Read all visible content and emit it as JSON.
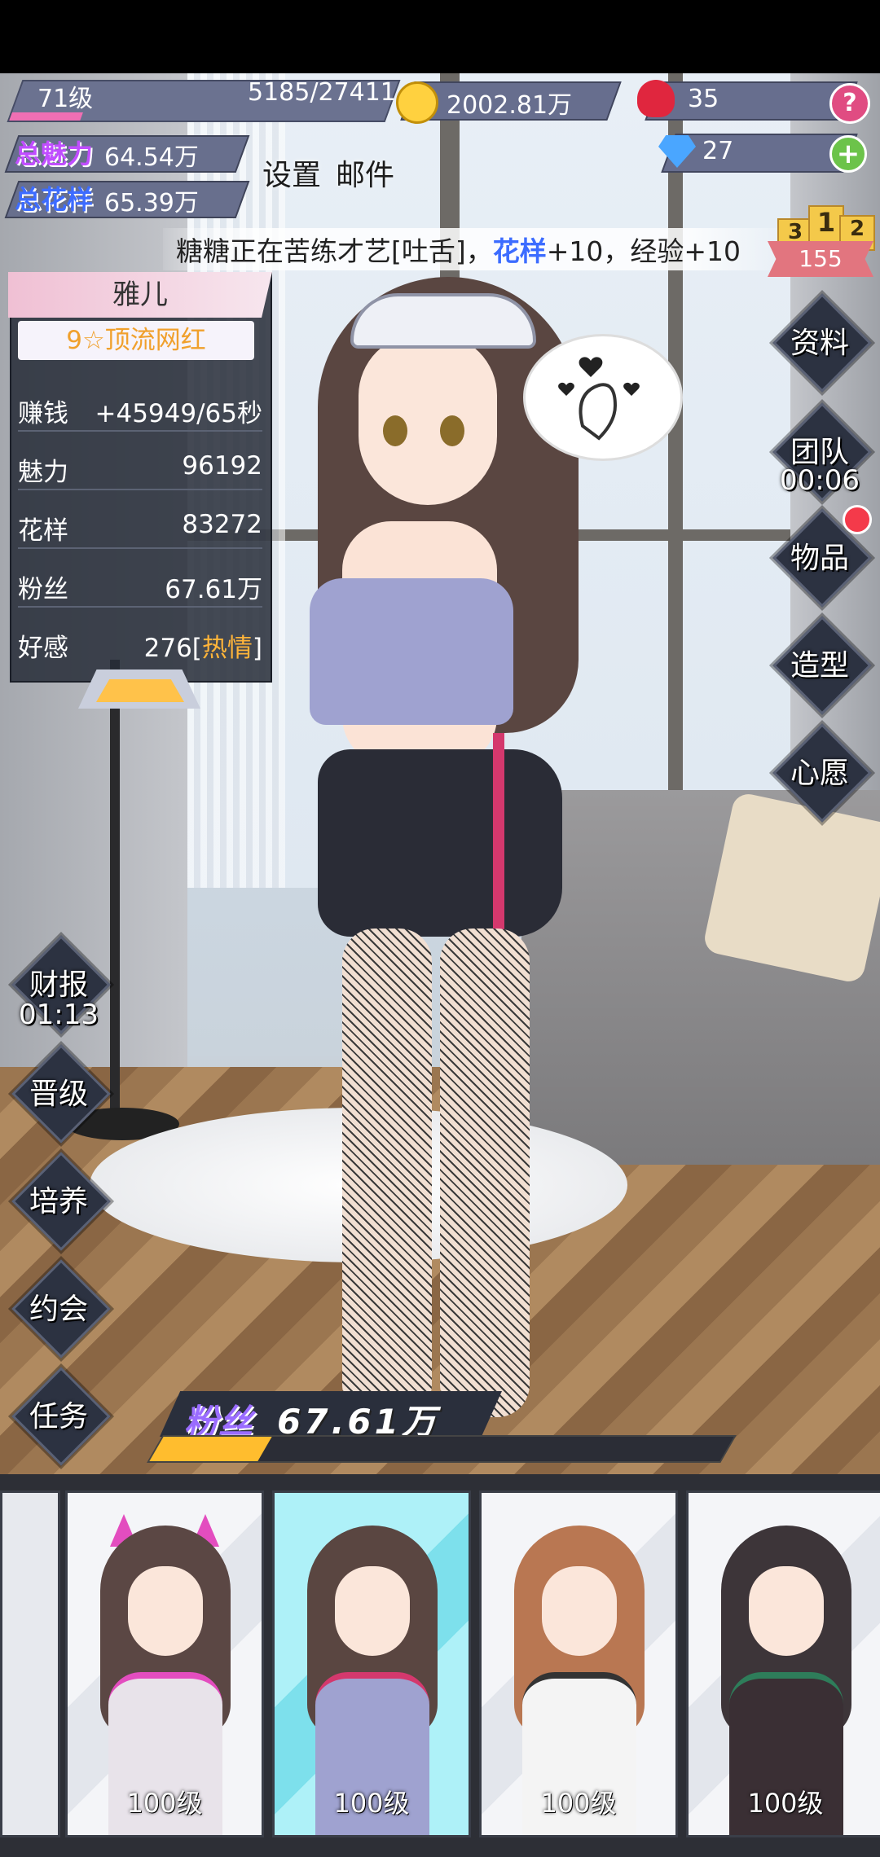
{
  "hud": {
    "level": "71级",
    "exp": "5185/27411",
    "exp_fraction": 0.19,
    "gold": "2002.81万",
    "roses": "35",
    "diamonds": "27",
    "help": "?",
    "add": "+",
    "total_charm_label": "总魅力",
    "total_charm": "64.54万",
    "total_style_label": "总花样",
    "total_style": "65.39万",
    "settings_label": "设置",
    "mail_label": "邮件"
  },
  "ticker": {
    "prefix": "糖糖正在苦练才艺[吐舌]，",
    "em": "花样",
    "suffix": "+10，经验+10"
  },
  "ranking": {
    "first": "1",
    "second": "2",
    "third": "3",
    "count": "155"
  },
  "girl": {
    "name": "雅儿",
    "title": "9☆顶流网红",
    "stats": [
      {
        "k": "赚钱",
        "v": "+45949/65秒"
      },
      {
        "k": "魅力",
        "v": "96192"
      },
      {
        "k": "花样",
        "v": "83272"
      },
      {
        "k": "粉丝",
        "v": "67.61万"
      },
      {
        "k": "好感",
        "v": "276[",
        "hot": "热情",
        "end": "]"
      }
    ]
  },
  "right_menu": {
    "profile": "资料",
    "team": "团队",
    "team_timer": "00:06",
    "items": "物品",
    "styling": "造型",
    "wish": "心愿"
  },
  "left_menu": {
    "finance": "财报",
    "finance_timer": "01:13",
    "promote": "晋级",
    "train": "培养",
    "date": "约会",
    "tasks": "任务"
  },
  "fans": {
    "label": "粉丝",
    "value": "67.61万",
    "fraction": 0.19
  },
  "roster": [
    {
      "level": "100级",
      "hair": "#5b4744",
      "outfit": "#e8e3ea",
      "accent": "#e34dbf"
    },
    {
      "level": "100级",
      "hair": "#5a4641",
      "outfit": "#9fa2d0",
      "accent": "#d4386d"
    },
    {
      "level": "100级",
      "hair": "#b97752",
      "outfit": "#f4f4f4",
      "accent": "#333333"
    },
    {
      "level": "100级",
      "hair": "#3d3539",
      "outfit": "#3a2f34",
      "accent": "#2e7d5a"
    }
  ]
}
